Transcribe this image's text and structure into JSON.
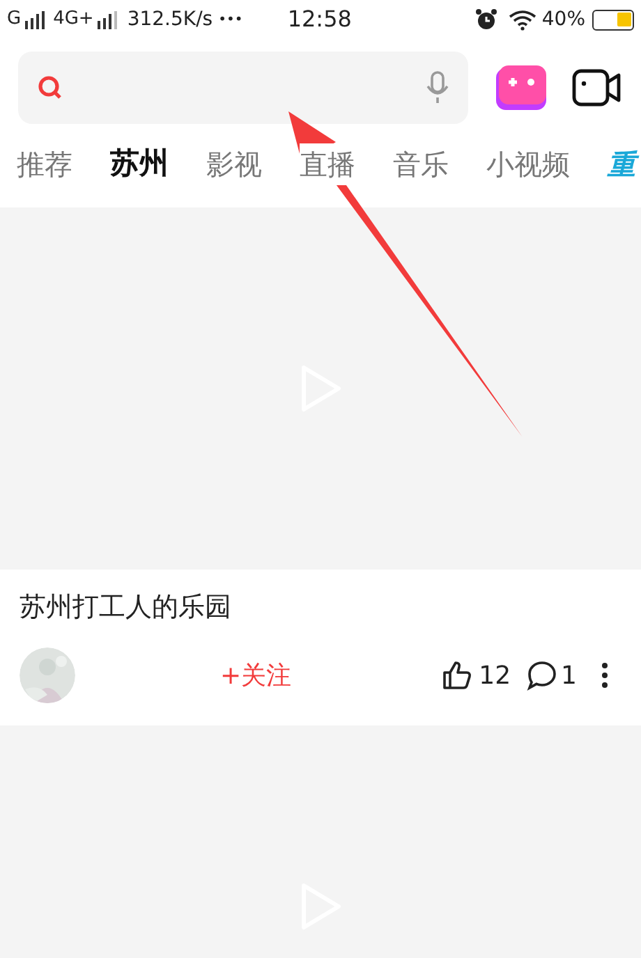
{
  "status_bar": {
    "signal_1": "G",
    "signal_2": "4G+",
    "speed": "312.5K/s",
    "more": "•••",
    "time": "12:58",
    "battery": "40%"
  },
  "tabs": [
    {
      "label": "推荐",
      "selected": false,
      "kind": "normal"
    },
    {
      "label": "苏州",
      "selected": true,
      "kind": "normal"
    },
    {
      "label": "影视",
      "selected": false,
      "kind": "normal"
    },
    {
      "label": "直播",
      "selected": false,
      "kind": "normal"
    },
    {
      "label": "音乐",
      "selected": false,
      "kind": "normal"
    },
    {
      "label": "小视频",
      "selected": false,
      "kind": "normal"
    },
    {
      "label": "重",
      "selected": false,
      "kind": "special"
    }
  ],
  "feed": [
    {
      "kind": "video"
    },
    {
      "kind": "post",
      "title": "苏州打工人的乐园",
      "follow": "+关注",
      "likes": "12",
      "comments": "1"
    },
    {
      "kind": "video"
    }
  ]
}
